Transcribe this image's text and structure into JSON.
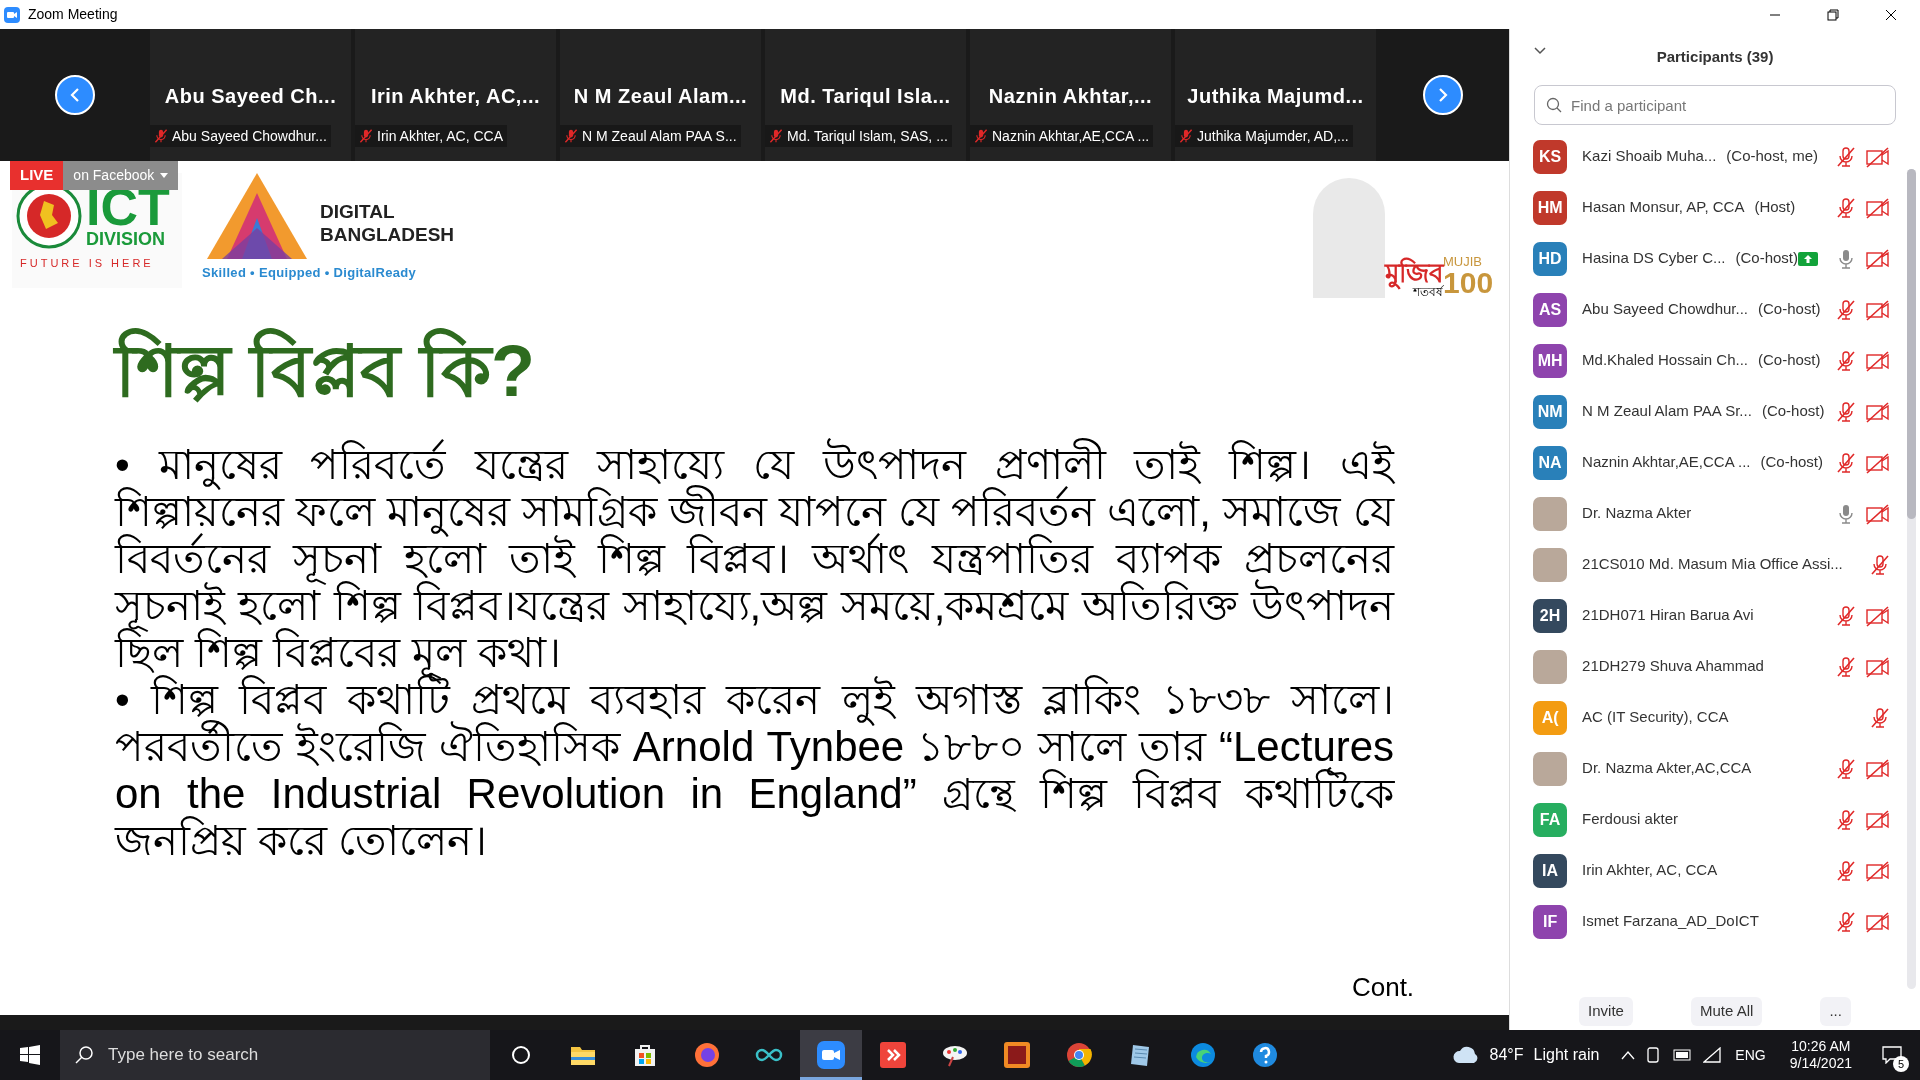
{
  "window": {
    "title": "Zoom Meeting"
  },
  "thumbnails": [
    {
      "name": "Abu Sayeed Ch...",
      "label": "Abu Sayeed Chowdhur...",
      "muted": true
    },
    {
      "name": "Irin Akhter, AC,...",
      "label": "Irin Akhter, AC, CCA",
      "muted": true
    },
    {
      "name": "N M Zeaul Alam...",
      "label": "N M Zeaul Alam PAA S...",
      "muted": true
    },
    {
      "name": "Md. Tariqul Isla...",
      "label": "Md. Tariqul Islam, SAS, ...",
      "muted": true
    },
    {
      "name": "Naznin Akhtar,...",
      "label": "Naznin Akhtar,AE,CCA ...",
      "muted": true
    },
    {
      "name": "Juthika Majumd...",
      "label": "Juthika Majumder, AD,...",
      "muted": true
    }
  ],
  "live": {
    "badge": "LIVE",
    "destination": "on Facebook"
  },
  "slide": {
    "logos": {
      "ict": "ICT",
      "division": "DIVISION",
      "tagline": "FUTURE IS HERE",
      "digital": "DIGITAL",
      "bangladesh": "BANGLADESH",
      "motto": "Skilled • Equipped • DigitalReady",
      "mujib_bn": "মুজিব",
      "shatabarsha": "শতবর্ষ",
      "mujib": "MUJIB",
      "hundred": "100"
    },
    "title": "শিল্প বিপ্লব কি?",
    "paragraphs": [
      "• মানুষের পরিবর্তে যন্ত্রের সাহায্যে যে উৎপাদন প্রণালী তাই শিল্প। এই শিল্পায়নের ফলে মানুষের সামগ্রিক জীবন যাপনে যে পরিবর্তন এলো, সমাজে যে বিবর্তনের সূচনা হলো তাই শিল্প বিপ্লব। অর্থাৎ যন্ত্রপাতির ব্যাপক প্রচলনের সূচনাই হলো শিল্প বিপ্লব।যন্ত্রের সাহায্যে,অল্প সময়ে,কমশ্রমে অতিরিক্ত উৎপাদন ছিল শিল্প বিপ্লবের মূল কথা।",
      "• শিল্প বিপ্লব কথাটি প্রথমে ব্যবহার করেন লুই অগাস্ত ব্লাকিং ১৮৩৮ সালে। পরবর্তীতে ইংরেজি ঐতিহাসিক Arnold Tynbee ১৮৮০ সালে তার “Lectures on the Industrial Revolution in England” গ্রন্থে শিল্প বিপ্লব কথাটিকে জনপ্রিয় করে তোলেন।"
    ],
    "footer": "Cont."
  },
  "participants": {
    "title": "Participants (39)",
    "search": {
      "placeholder": "Find a participant"
    },
    "items": [
      {
        "kind": "initials",
        "initials": "KS",
        "color": "#c0392b",
        "name": "Kazi Shoaib Muha...",
        "role": "(Co-host, me)",
        "sharing": false,
        "muted": true,
        "video_off": true
      },
      {
        "kind": "initials",
        "initials": "HM",
        "color": "#c0392b",
        "name": "Hasan Monsur, AP, CCA",
        "role": "(Host)",
        "sharing": false,
        "muted": true,
        "video_off": true
      },
      {
        "kind": "initials",
        "initials": "HD",
        "color": "#2980b9",
        "name": "Hasina DS Cyber C...",
        "role": "(Co-host)",
        "sharing": true,
        "muted": false,
        "video_off": true
      },
      {
        "kind": "initials",
        "initials": "AS",
        "color": "#8e44ad",
        "name": "Abu Sayeed Chowdhur...",
        "role": "(Co-host)",
        "sharing": false,
        "muted": true,
        "video_off": true
      },
      {
        "kind": "initials",
        "initials": "MH",
        "color": "#8e44ad",
        "name": "Md.Khaled Hossain Ch...",
        "role": "(Co-host)",
        "sharing": false,
        "muted": true,
        "video_off": true
      },
      {
        "kind": "initials",
        "initials": "NM",
        "color": "#2980b9",
        "name": "N M Zeaul Alam PAA Sr...",
        "role": "(Co-host)",
        "sharing": false,
        "muted": true,
        "video_off": true
      },
      {
        "kind": "initials",
        "initials": "NA",
        "color": "#2980b9",
        "name": "Naznin Akhtar,AE,CCA ...",
        "role": "(Co-host)",
        "sharing": false,
        "muted": true,
        "video_off": true
      },
      {
        "kind": "photo",
        "name": "Dr. Nazma Akter",
        "sharing": false,
        "muted": false,
        "video_off": true
      },
      {
        "kind": "photo",
        "name": "21CS010 Md. Masum Mia Office Assi...",
        "sharing": false,
        "muted": true,
        "video_off": false
      },
      {
        "kind": "initials",
        "initials": "2H",
        "color": "#34495e",
        "name": "21DH071 Hiran Barua Avi",
        "sharing": false,
        "muted": true,
        "video_off": true
      },
      {
        "kind": "photo",
        "name": "21DH279 Shuva Ahammad",
        "sharing": false,
        "muted": true,
        "video_off": true
      },
      {
        "kind": "initials",
        "initials": "A(",
        "color": "#f39c12",
        "name": "AC (IT Security), CCA",
        "sharing": false,
        "muted": true,
        "video_off": false
      },
      {
        "kind": "photo",
        "name": "Dr. Nazma Akter,AC,CCA",
        "sharing": false,
        "muted": true,
        "video_off": true
      },
      {
        "kind": "initials",
        "initials": "FA",
        "color": "#27ae60",
        "name": "Ferdousi akter",
        "sharing": false,
        "muted": true,
        "video_off": true
      },
      {
        "kind": "initials",
        "initials": "IA",
        "color": "#34495e",
        "name": "Irin Akhter, AC, CCA",
        "sharing": false,
        "muted": true,
        "video_off": true
      },
      {
        "kind": "initials",
        "initials": "IF",
        "color": "#8e44ad",
        "name": "Ismet Farzana_AD_DoICT",
        "sharing": false,
        "muted": true,
        "video_off": true
      }
    ],
    "buttons": [
      "Invite",
      "Mute All",
      "..."
    ]
  },
  "taskbar": {
    "search_placeholder": "Type here to search",
    "apps": [
      {
        "kind": "cortana",
        "selected": false
      },
      {
        "kind": "explorer",
        "selected": false
      },
      {
        "kind": "store",
        "selected": false
      },
      {
        "kind": "firefox",
        "selected": false
      },
      {
        "kind": "infinity",
        "selected": false
      },
      {
        "kind": "zoom",
        "selected": true
      },
      {
        "kind": "anydesk",
        "selected": false
      },
      {
        "kind": "paint",
        "selected": false
      },
      {
        "kind": "avro",
        "selected": false
      },
      {
        "kind": "chrome",
        "selected": false
      },
      {
        "kind": "notepad",
        "selected": false
      },
      {
        "kind": "edge",
        "selected": false
      },
      {
        "kind": "help",
        "selected": false
      }
    ],
    "temperature": "84°F",
    "weather": "Light rain",
    "language": "ENG",
    "time": "10:26 AM",
    "date": "9/14/2021",
    "notifications": "5"
  }
}
